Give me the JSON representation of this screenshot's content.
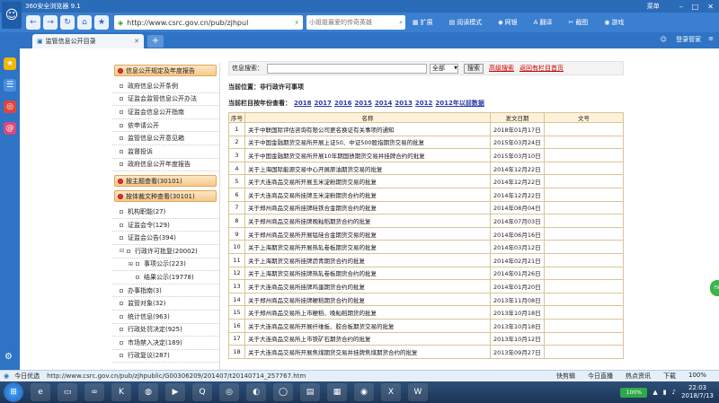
{
  "browser": {
    "title": "360安全浏览器 9.1",
    "menu": "菜单",
    "url": "http://www.csrc.gov.cn/pub/zjhpul",
    "search_placeholder": "小姐姐最爱的传奇英雄",
    "tools": [
      "扩展",
      "阅读模式",
      "网银",
      "翻译",
      "截图",
      "游戏"
    ],
    "login": "登录管家",
    "tab_title": "监管信息公开目录",
    "new_tab": "+"
  },
  "leftnav": {
    "section1": "信息公开规定及年度报告",
    "section1_items": [
      "政府信息公开条例",
      "证监会监管信息公开办法",
      "证监会信息公开指南",
      "依申请公开",
      "监管信息公开意见箱",
      "监督投诉",
      "政府信息公开年度报告"
    ],
    "section2": "按主题查看(30101)",
    "section3": "按体裁文种查看(30101)",
    "section3_items": [
      {
        "label": "机构职能(27)",
        "level": 1
      },
      {
        "label": "证监会令(129)",
        "level": 1
      },
      {
        "label": "证监会公告(394)",
        "level": 1
      },
      {
        "label": "行政许可批复(20002)",
        "level": 1,
        "expander": "⊟"
      },
      {
        "label": "事项公示(223)",
        "level": 2,
        "expander": "⊞"
      },
      {
        "label": "结果公示(19778)",
        "level": 3
      },
      {
        "label": "办事指南(3)",
        "level": 1
      },
      {
        "label": "监管对象(32)",
        "level": 1
      },
      {
        "label": "统计信息(963)",
        "level": 1
      },
      {
        "label": "行政处罚决定(925)",
        "level": 1
      },
      {
        "label": "市场禁入决定(189)",
        "level": 1
      },
      {
        "label": "行政复议(287)",
        "level": 1
      }
    ]
  },
  "main": {
    "search_label": "信息搜索：",
    "search_value": "",
    "scope": "全部",
    "search_btn": "搜索",
    "advanced": "高级搜索",
    "back": "返回有栏目首页",
    "position": "当前位置：非行政许可事项",
    "year_label": "当前栏目按年份查看：",
    "years": [
      "2018",
      "2017",
      "2016",
      "2015",
      "2014",
      "2013",
      "2012",
      "2012年以前数据"
    ],
    "columns": [
      "序号",
      "名称",
      "发文日期",
      "文号"
    ],
    "rows": [
      {
        "i": "1",
        "t": "关于中联国际评估咨询有限公司更名换证有关事项的通知",
        "d": "2018年01月17日",
        "n": ""
      },
      {
        "i": "2",
        "t": "关于中国金融期货交易所开展上证50、中证500股指期货交易的批复",
        "d": "2015年03月24日",
        "n": ""
      },
      {
        "i": "3",
        "t": "关于中国金融期货交易所开展10年期国债期货交易并挂牌合约的批复",
        "d": "2015年03月10日",
        "n": ""
      },
      {
        "i": "4",
        "t": "关于上海国际能源交易中心开展原油期货交易的批复",
        "d": "2014年12月22日",
        "n": ""
      },
      {
        "i": "5",
        "t": "关于大连商品交易所开展玉米淀粉期货交易的批复",
        "d": "2014年12月22日",
        "n": ""
      },
      {
        "i": "6",
        "t": "关于大连商品交易所挂牌玉米淀粉期货合约的批复",
        "d": "2014年12月22日",
        "n": ""
      },
      {
        "i": "7",
        "t": "关于郑州商品交易所挂牌硅铁合金期货合约的批复",
        "d": "2014年08月04日",
        "n": ""
      },
      {
        "i": "8",
        "t": "关于郑州商品交易所挂牌晚籼稻期货合约的批复",
        "d": "2014年07月03日",
        "n": ""
      },
      {
        "i": "9",
        "t": "关于郑州商品交易所开展锰硅合金期货交易的批复",
        "d": "2014年06月16日",
        "n": ""
      },
      {
        "i": "10",
        "t": "关于上海期货交易所开展热轧卷板期货交易的批复",
        "d": "2014年03月12日",
        "n": ""
      },
      {
        "i": "11",
        "t": "关于上海期货交易所挂牌沥青期货合约的批复",
        "d": "2014年02月21日",
        "n": ""
      },
      {
        "i": "12",
        "t": "关于上海期货交易所挂牌热轧卷板期货合约的批复",
        "d": "2014年01月26日",
        "n": ""
      },
      {
        "i": "13",
        "t": "关于大连商品交易所挂牌鸡蛋期货合约的批复",
        "d": "2014年01月20日",
        "n": ""
      },
      {
        "i": "14",
        "t": "关于郑州商品交易所挂牌粳稻期货合约的批复",
        "d": "2013年11月08日",
        "n": ""
      },
      {
        "i": "15",
        "t": "关于郑州商品交易所上市粳稻、晚籼稻期货的批复",
        "d": "2013年10月18日",
        "n": ""
      },
      {
        "i": "16",
        "t": "关于大连商品交易所开展纤维板、胶合板期货交易的批复",
        "d": "2013年10月18日",
        "n": ""
      },
      {
        "i": "17",
        "t": "关于大连商品交易所上市铁矿石期货合约的批复",
        "d": "2013年10月12日",
        "n": ""
      },
      {
        "i": "18",
        "t": "关于大连商品交易所开展焦煤期货交易并挂牌焦煤期货合约的批复",
        "d": "2013年09月27日",
        "n": ""
      }
    ]
  },
  "statusbar": {
    "optimize": "今日优选",
    "url": "http://www.csrc.gov.cn/pub/zjhpublic/G00306209/201407/t20140714_257767.htm",
    "items": [
      "快剪辑",
      "今日直播",
      "热点资讯",
      "下载",
      "100%"
    ]
  },
  "taskbar": {
    "battery": "100%",
    "time": "22:03",
    "date": "2018/7/13"
  }
}
